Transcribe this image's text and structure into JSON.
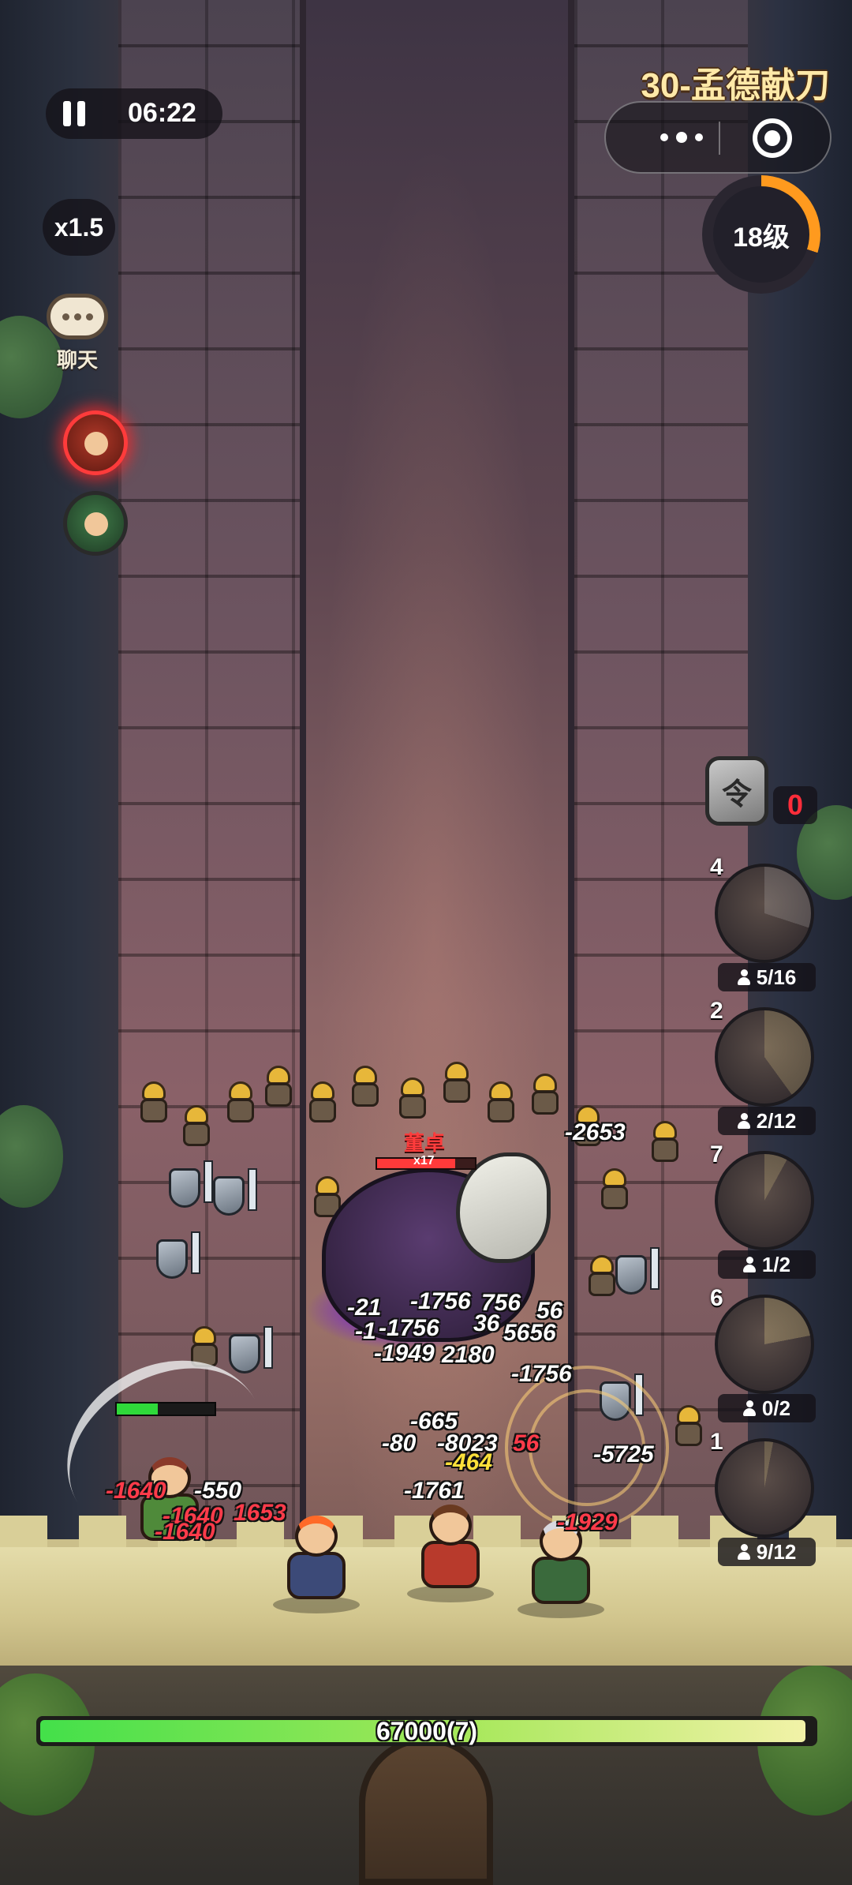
{
  "hud": {
    "pause_icon": "pause-icon",
    "timer": "06:22",
    "speed": "x1.5",
    "chat_label": "聊天",
    "stage_title": "30-孟德献刀",
    "level": "18级",
    "level_progress": 0.3
  },
  "token": {
    "icon_glyph": "令",
    "count": "0"
  },
  "units": [
    {
      "slot": "4",
      "count": "5/16"
    },
    {
      "slot": "2",
      "count": "2/12"
    },
    {
      "slot": "7",
      "count": "1/2"
    },
    {
      "slot": "6",
      "count": "0/2"
    },
    {
      "slot": "1",
      "count": "9/12"
    }
  ],
  "boss": {
    "name": "董卓",
    "count": "x17"
  },
  "damage_numbers": {
    "d1": "-2653",
    "d2": "-21",
    "d3": "-1756",
    "d4": "756",
    "d5": "56",
    "d6": "-1",
    "d7": "-1756",
    "d8": "36",
    "d9": "5656",
    "d10": "-1949",
    "d11": "2180",
    "d12": "-1756",
    "d13": "-665",
    "d14": "-80",
    "d15": "-8023",
    "d16": "56",
    "d17": "-5725",
    "d18": "-464",
    "d19": "-1640",
    "d20": "-550",
    "d21": "-1640",
    "d22": "1653",
    "d23": "-1640",
    "d24": "-1761",
    "d25": "-1929"
  },
  "wave": {
    "label": "67000(7)",
    "progress": 0.99
  },
  "colors": {
    "level_ring": "#ff9a1e",
    "token_count": "#ff2d3a",
    "boss_name": "#ff3c3c",
    "wave_start": "#43e04a",
    "wave_end": "#f2f2a8"
  }
}
